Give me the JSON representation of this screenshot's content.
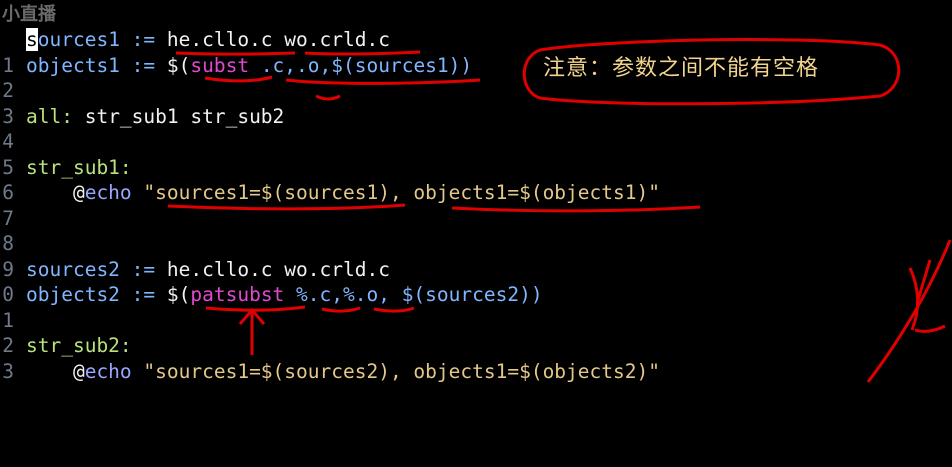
{
  "watermark": "小直播",
  "annotation_note": "注意：参数之间不能有空格",
  "lines": [
    {
      "ln": "",
      "tokens": [
        {
          "text": "s",
          "cls": "v cursor"
        },
        {
          "text": "ources1 := ",
          "cls": "v"
        },
        {
          "text": "he.cllo.c wo.crld.c",
          "cls": "w"
        }
      ]
    },
    {
      "ln": "1",
      "tokens": [
        {
          "text": "objects1 := ",
          "cls": "v"
        },
        {
          "text": "$(",
          "cls": "w"
        },
        {
          "text": "subst",
          "cls": "f"
        },
        {
          "text": " .c,.o,$(sources1))",
          "cls": "v"
        }
      ]
    },
    {
      "ln": "2",
      "tokens": []
    },
    {
      "ln": "3",
      "tokens": [
        {
          "text": "all:",
          "cls": "t"
        },
        {
          "text": " str_sub1 str_sub2",
          "cls": "w"
        }
      ]
    },
    {
      "ln": "4",
      "tokens": []
    },
    {
      "ln": "5",
      "tokens": [
        {
          "text": "str_sub1:",
          "cls": "t"
        }
      ]
    },
    {
      "ln": "6",
      "tokens": [
        {
          "text": "    @",
          "cls": "w"
        },
        {
          "text": "echo",
          "cls": "k"
        },
        {
          "text": " \"sources1=$(sources1), objects1=$(objects1)\"",
          "cls": "s"
        }
      ]
    },
    {
      "ln": "7",
      "tokens": []
    },
    {
      "ln": "8",
      "tokens": []
    },
    {
      "ln": "9",
      "tokens": [
        {
          "text": "sources2 := ",
          "cls": "v"
        },
        {
          "text": "he.cllo.c wo.crld.c",
          "cls": "w"
        }
      ]
    },
    {
      "ln": "0",
      "tokens": [
        {
          "text": "objects2 := ",
          "cls": "v"
        },
        {
          "text": "$(",
          "cls": "w"
        },
        {
          "text": "patsubst",
          "cls": "f"
        },
        {
          "text": " %.c,%.o, $(sources2))",
          "cls": "v"
        }
      ]
    },
    {
      "ln": "1",
      "tokens": []
    },
    {
      "ln": "2",
      "tokens": [
        {
          "text": "str_sub2:",
          "cls": "t"
        }
      ]
    },
    {
      "ln": "3",
      "tokens": [
        {
          "text": "    @",
          "cls": "w"
        },
        {
          "text": "echo",
          "cls": "k"
        },
        {
          "text": " \"sources1=$(sources2), objects1=$(objects2)\"",
          "cls": "s"
        }
      ]
    }
  ]
}
